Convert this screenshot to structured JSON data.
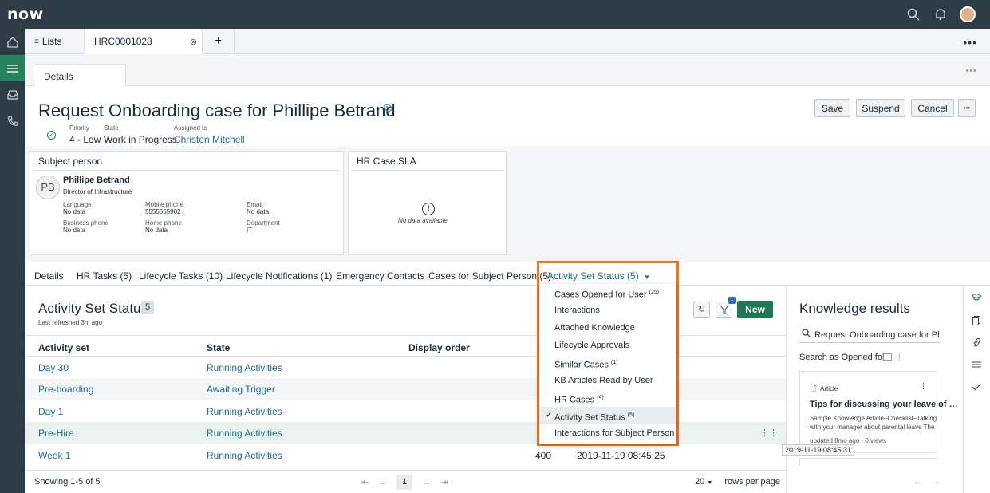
{
  "app": {
    "logo": "now"
  },
  "tabs": {
    "lists_label": "Lists",
    "case_label": "HRC0001028",
    "add_label": "+"
  },
  "subtab": {
    "label": "Details"
  },
  "record": {
    "title": "Request Onboarding case for Phillipe Betrand",
    "priority_label": "Priority",
    "priority_value": "4 - Low",
    "state_label": "State",
    "state_value": "Work in Progress",
    "assigned_label": "Assigned to",
    "assigned_value": "Christen Mitchell"
  },
  "actions": {
    "save": "Save",
    "suspend": "Suspend",
    "cancel": "Cancel",
    "more": "•••"
  },
  "subject": {
    "card_title": "Subject person",
    "initials": "PB",
    "name": "Phillipe Betrand",
    "role": "Director of Infrastructure",
    "fields": [
      {
        "label": "Language",
        "value": "No data"
      },
      {
        "label": "Mobile phone",
        "value": "5555555902"
      },
      {
        "label": "Email",
        "value": "No data"
      },
      {
        "label": "Business phone",
        "value": "No data"
      },
      {
        "label": "Home phone",
        "value": "No data"
      },
      {
        "label": "Department",
        "value": "IT"
      }
    ]
  },
  "sla": {
    "card_title": "HR Case SLA",
    "empty_text": "No data available"
  },
  "related_tabs": [
    "Details",
    "HR Tasks (5)",
    "Lifecycle Tasks (10)",
    "Lifecycle Notifications (1)",
    "Emergency Contacts",
    "Cases for Subject Person (5)",
    "Activity Set Status (5)"
  ],
  "list": {
    "title": "Activity Set Status",
    "count": "5",
    "refreshed": "Last refreshed 3m ago",
    "filter_badge": "1",
    "new_label": "New",
    "columns": [
      "Activity set",
      "State",
      "Display order"
    ],
    "rows": [
      {
        "activity": "Day 30",
        "state": "Running Activities",
        "order": "",
        "date": ""
      },
      {
        "activity": "Pre-boarding",
        "state": "Awaiting Trigger",
        "order": "",
        "date": ""
      },
      {
        "activity": "Day 1",
        "state": "Running Activities",
        "order": "",
        "date": ""
      },
      {
        "activity": "Pre-Hire",
        "state": "Running Activities",
        "order": "",
        "date": ""
      },
      {
        "activity": "Week 1",
        "state": "Running Activities",
        "order": "400",
        "date": "2019-11-19 08:45:25"
      }
    ],
    "tooltip": "2019-11-19 08:45:31",
    "showing": "Showing 1-5 of 5",
    "page": "1",
    "rows_per_page_value": "20",
    "rows_per_page_label": "rows per page"
  },
  "dropdown": {
    "items": [
      {
        "label": "Cases Opened for User",
        "sup": "(25)"
      },
      {
        "label": "Interactions",
        "sup": ""
      },
      {
        "label": "Attached Knowledge",
        "sup": ""
      },
      {
        "label": "Lifecycle Approvals",
        "sup": ""
      },
      {
        "label": "Similar Cases",
        "sup": "(1)"
      },
      {
        "label": "KB Articles Read by User",
        "sup": ""
      },
      {
        "label": "HR Cases",
        "sup": "(4)"
      },
      {
        "label": "Activity Set Status",
        "sup": "(5)"
      },
      {
        "label": "Interactions for Subject Person",
        "sup": ""
      }
    ],
    "check": "✓"
  },
  "knowledge": {
    "title": "Knowledge results",
    "search_value": "Request Onboarding case for Phillipe Betrand",
    "opened_for_label": "Search as Opened for",
    "article_type": "Article",
    "article_title": "Tips for discussing your leave of …",
    "article_desc": "Sample Knowledge Article–Checklist–Talking with your manager about parental leave The",
    "article_meta": "updated 8mo ago · 0 views"
  },
  "colors": {
    "accent": "#1d7a53",
    "highlight": "#e87722",
    "link": "#1f6f8b",
    "nav_bg": "#2e3d45"
  }
}
